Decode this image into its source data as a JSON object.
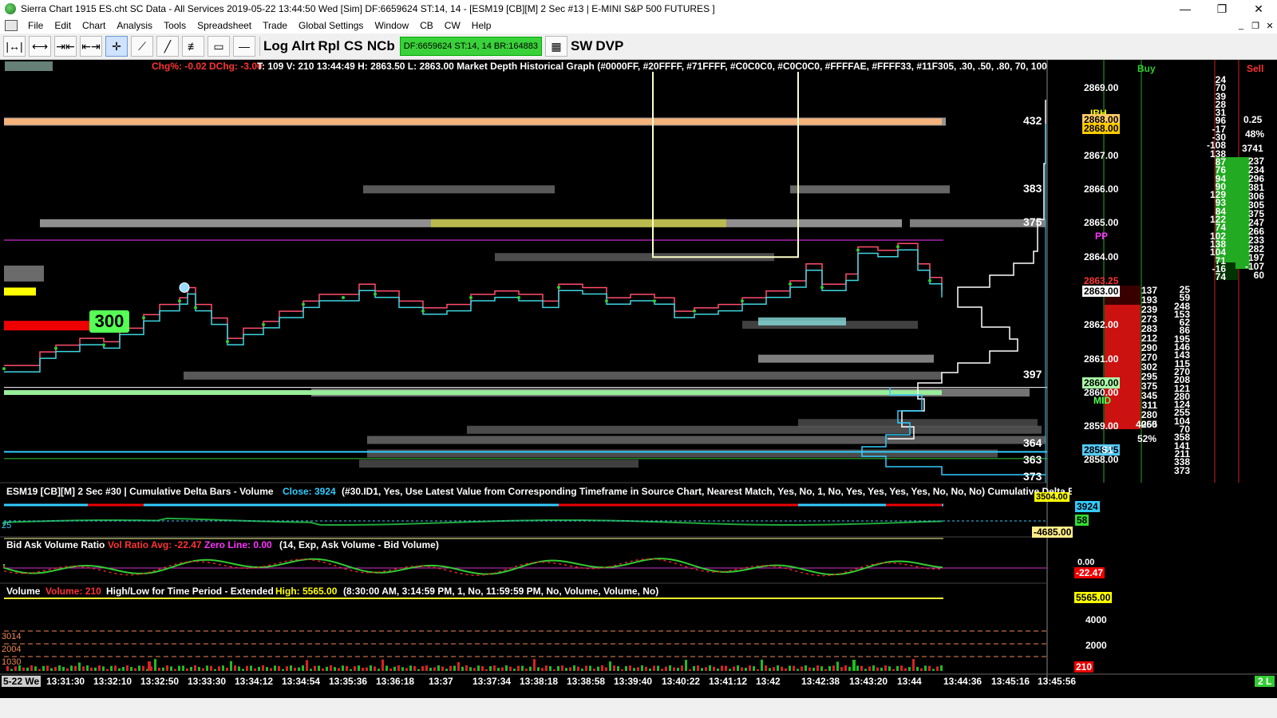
{
  "window": {
    "title": "Sierra Chart 1915 ES.cht  SC Data - All Services 2019-05-22  13:44:50 Wed [Sim]  DF:6659624  ST:14, 14 - [ESM19 [CB][M]  2 Sec  #13 | E-MINI S&P 500 FUTURES ]",
    "minimize": "—",
    "maximize": "❐",
    "close": "✕"
  },
  "menu": [
    "File",
    "Edit",
    "Chart",
    "Analysis",
    "Tools",
    "Spreadsheet",
    "Trade",
    "Global Settings",
    "Window",
    "CB",
    "CW",
    "Help"
  ],
  "toolbar": {
    "icons": [
      "bar-spacing-decrease-icon",
      "bar-spacing-increase-icon",
      "scale-compress-icon",
      "scale-expand-icon",
      "crosshair-icon",
      "draw-ray-icon",
      "draw-line-icon",
      "fib-tool-icon",
      "rectangle-tool-icon",
      "horizontal-line-icon"
    ],
    "buttons": [
      "Log",
      "Alrt",
      "Rpl",
      "CS",
      "NCb"
    ],
    "df_status": "DF:6659624  ST:14, 14  BR:164883",
    "extra_buttons": [
      "SW",
      "DVP"
    ]
  },
  "main_chart": {
    "header_red": "Chg%: -0.02 DChg: -3.00",
    "header_white": "T: 109 V: 210 13:44:49 H: 2863.50 L: 2863.00 Market Depth Historical Graph  (#0000FF, #20FFFF, #71FFFF, #C0C0C0, #C0C0C0, #FFFFAE, #FFFF33, #11F305, .30, .50, .80, 70, 1000, Perc",
    "big_order": "300",
    "depth_sizes": [
      "432",
      "383",
      "375",
      "397",
      "364",
      "363",
      "373"
    ],
    "level_labels": {
      "ibh": "IBH",
      "pp": "PP",
      "mid": "MID",
      "s1": "S1"
    }
  },
  "price_axis": {
    "labels": [
      "2869.00",
      "2868.00",
      "2867.00",
      "2866.00",
      "2865.00",
      "2864.00",
      "2863.00",
      "2862.00",
      "2861.00",
      "2860.00",
      "2859.00",
      "2858.00"
    ],
    "box_2868": "2868.00",
    "box_2863_red": "2863.25",
    "box_2863": "2863.00",
    "box_2860": "2860.00",
    "box_2858": "2858.25"
  },
  "dom": {
    "buy_label": "Buy",
    "sell_label": "Sell",
    "bid_sizes": [
      "137",
      "193",
      "239",
      "273",
      "283",
      "212",
      "290",
      "270",
      "302",
      "295",
      "375",
      "345",
      "311",
      "280",
      "255"
    ],
    "bid_total": "4060",
    "bid_pct": "52%",
    "ask_sizes": [
      "25",
      "59",
      "248",
      "153",
      "62",
      "86",
      "195",
      "146",
      "143",
      "115",
      "270",
      "208",
      "121",
      "280",
      "124",
      "255",
      "104",
      "70",
      "358",
      "141",
      "211",
      "338",
      "373"
    ],
    "col3_top": [
      "24",
      "70",
      "39",
      "28",
      "31",
      "96",
      "-17",
      "-30",
      "-108",
      "138",
      "87",
      "76",
      "94",
      "90",
      "129",
      "93",
      "84",
      "122",
      "74",
      "102",
      "138",
      "104",
      "71",
      "-16",
      "74"
    ],
    "sell_pct_a": "0.25",
    "sell_pct_b": "48%",
    "sell_total": "3741",
    "sell_sizes": [
      "237",
      "234",
      "296",
      "381",
      "306",
      "305",
      "375",
      "247",
      "266",
      "233",
      "282",
      "197",
      "-107",
      "60"
    ]
  },
  "subgraph_delta": {
    "header": "ESM19 [CB][M]  2 Sec   #30 | Cumulative Delta Bars - Volume",
    "close": "Close: 3924",
    "params": "(#30.ID1, Yes, Use Latest Value from Corresponding Timeframe in Source Chart, Nearest Match, Yes, No, 1, No, Yes, Yes, Yes, Yes, No, No, No)  Cumulative Delta Ba",
    "value_box": "3924",
    "value_box2": "58",
    "value_box3": "-4685.00",
    "value_box4": "3504.00",
    "left_label": "25"
  },
  "subgraph_ratio": {
    "header": "Bid Ask Volume Ratio",
    "avg": "Vol Ratio Avg: -22.47",
    "zero": "Zero Line: 0.00",
    "params": "(14, Exp, Ask Volume - Bid Volume)",
    "value_box": "-22.47",
    "zero_box": "0.00"
  },
  "subgraph_volume": {
    "header": "Volume",
    "vol": "Volume: 210",
    "study": "High/Low for Time Period - Extended",
    "high": "High: 5565.00",
    "params": "(8:30:00 AM, 3:14:59 PM, 1, No, 11:59:59 PM, No, Volume, Volume, No)",
    "high_box": "5565.00",
    "axis": [
      "4000",
      "2000"
    ],
    "left_levels": [
      "3014",
      "2004",
      "1030"
    ],
    "value_box": "210"
  },
  "time_axis": {
    "first": "5-22 We",
    "labels": [
      "13:31:30",
      "13:32:10",
      "13:32:50",
      "13:33:30",
      "13:34:12",
      "13:34:54",
      "13:35:36",
      "13:36:18",
      "13:37",
      "13:37:34",
      "13:38:18",
      "13:38:58",
      "13:39:40",
      "13:40:22",
      "13:41:12",
      "13:42",
      "13:42:38",
      "13:43:20",
      "13:44",
      "13:44:36",
      "13:45:16",
      "13:45:56"
    ],
    "corner": "2 L"
  },
  "colors": {
    "price_up": "#ff4d6d",
    "price_down": "#3fd6e0",
    "delta_green": "#1fa83a",
    "ratio_line": "#33cc33",
    "volume_high": "#ffff33",
    "bid_red": "#cc0000",
    "ask_green": "#22aa22"
  }
}
